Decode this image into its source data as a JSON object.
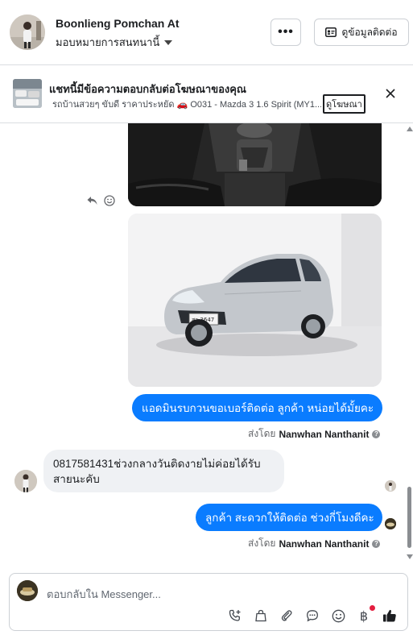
{
  "header": {
    "contact_name": "Boonlieng Pomchan At",
    "assign_label": "มอบหมายการสนทนานี้",
    "more_label": "•••",
    "contact_info_label": "ดูข้อมูลติดต่อ"
  },
  "ad_banner": {
    "title": "แชทนี้มีข้อความตอบกลับต่อโฆษณาของคุณ",
    "subtitle": "รถบ้านสวยๆ ขับดี ราคาประหยัด 🚗 O031 - Mazda 3 1.6 Spirit (MY1...",
    "link_label": "ดูโฆษณา"
  },
  "messages": [
    {
      "type": "image",
      "from": "page",
      "content": "car-interior-photo"
    },
    {
      "type": "image",
      "from": "page",
      "content": "car-exterior-photo",
      "plate": "สว 3647"
    },
    {
      "type": "text",
      "from": "page",
      "text": "แอดมินรบกวนขอเบอร์ติดต่อ ลูกค้า หน่อยได้มั้ยคะ"
    },
    {
      "type": "sent_by",
      "prefix": "ส่งโดย",
      "name": "Nanwhan Nanthanit"
    },
    {
      "type": "text",
      "from": "customer",
      "line1": "0817581431ช่วงกลางวันติดงายไม่ค่อยได้รับ",
      "line2": "สายนะคับ"
    },
    {
      "type": "text",
      "from": "page",
      "text": "ลูกค้า สะดวกให้ติดต่อ ช่วงกี่โมงดีคะ"
    },
    {
      "type": "sent_by",
      "prefix": "ส่งโดย",
      "name": "Nanwhan Nanthanit"
    }
  ],
  "composer": {
    "placeholder": "ตอบกลับใน Messenger...",
    "tools": [
      "call-add-icon",
      "shopping-bag-icon",
      "attachment-icon",
      "saved-reply-icon",
      "emoji-icon",
      "baht-payment-icon",
      "thumbs-up-icon"
    ],
    "baht_symbol": "฿"
  },
  "colors": {
    "accent": "#0a7cff",
    "incoming_bubble": "#eff1f4",
    "notification_dot": "#e41e3f"
  }
}
